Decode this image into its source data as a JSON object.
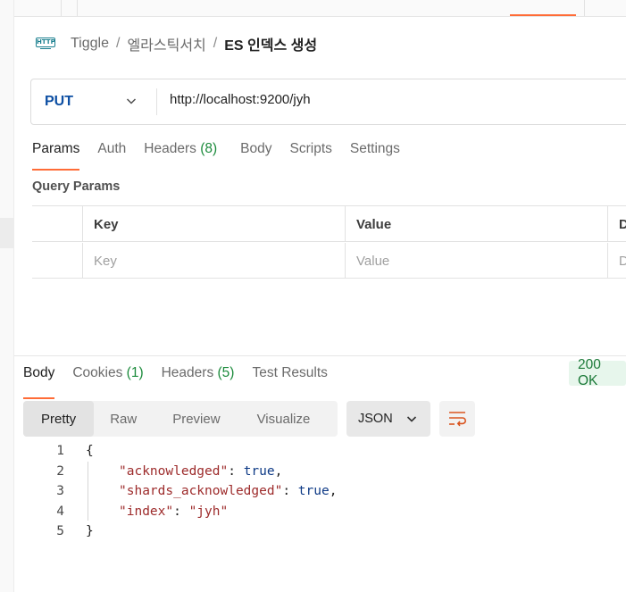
{
  "breadcrumb": {
    "icon": "http-request-icon",
    "icon_text": "HTTP",
    "items": [
      "Tiggle",
      "엘라스틱서치",
      "ES 인덱스 생성"
    ],
    "separator": "/"
  },
  "request": {
    "method": "PUT",
    "url": "http://localhost:9200/jyh"
  },
  "request_tabs": [
    {
      "label": "Params",
      "active": true
    },
    {
      "label": "Auth"
    },
    {
      "label": "Headers",
      "count": "(8)"
    },
    {
      "label": "Body"
    },
    {
      "label": "Scripts"
    },
    {
      "label": "Settings"
    }
  ],
  "query_params": {
    "title": "Query Params",
    "headers": [
      "Key",
      "Value",
      "D"
    ],
    "placeholders": [
      "Key",
      "Value",
      "D"
    ]
  },
  "response_tabs": [
    {
      "label": "Body",
      "active": true
    },
    {
      "label": "Cookies",
      "count": "(1)"
    },
    {
      "label": "Headers",
      "count": "(5)"
    },
    {
      "label": "Test Results"
    }
  ],
  "status": "200 OK",
  "view_modes": [
    "Pretty",
    "Raw",
    "Preview",
    "Visualize"
  ],
  "format": "JSON",
  "response_body": {
    "line_numbers": [
      "1",
      "2",
      "3",
      "4",
      "5"
    ],
    "open": "{",
    "close": "}",
    "lines": [
      {
        "key": "\"acknowledged\"",
        "value": "true",
        "type": "bool",
        "trail": ","
      },
      {
        "key": "\"shards_acknowledged\"",
        "value": "true",
        "type": "bool",
        "trail": ","
      },
      {
        "key": "\"index\"",
        "value": "\"jyh\"",
        "type": "string",
        "trail": ""
      }
    ]
  },
  "colors": {
    "accent": "#ff6c37",
    "method": "#0d4fa3",
    "count": "#1c8b3c",
    "status_bg": "#e7f6ec",
    "json_key": "#9d2b2b",
    "json_bool": "#0e3a86"
  }
}
